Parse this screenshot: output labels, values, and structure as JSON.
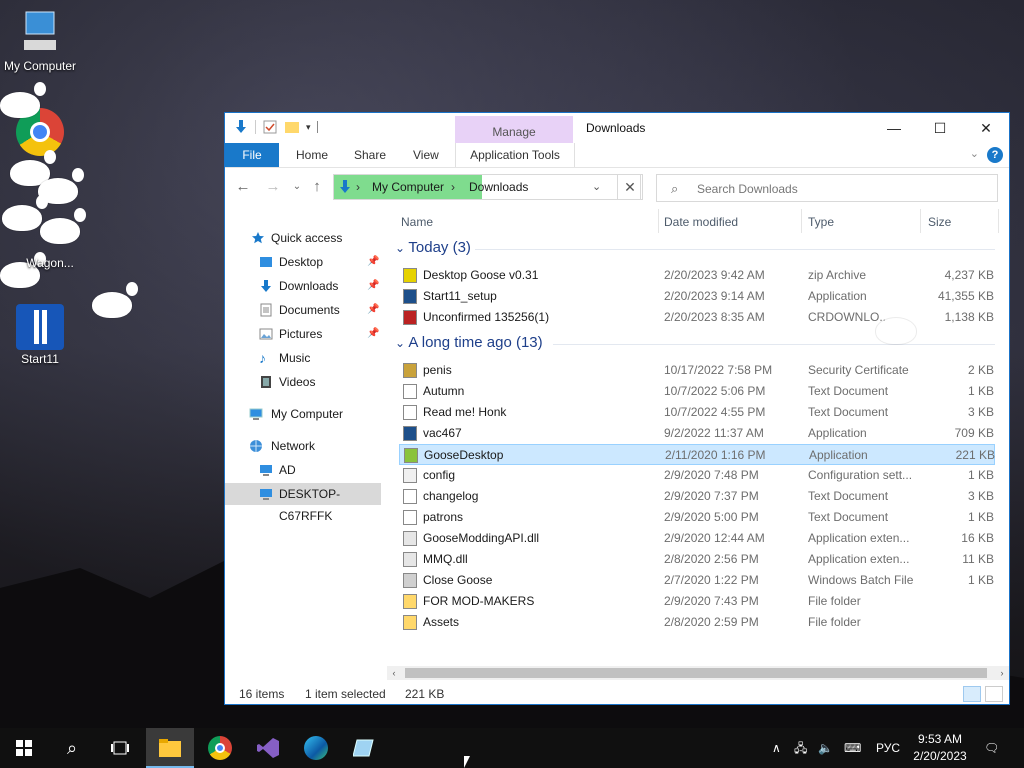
{
  "desktop": {
    "icons": [
      {
        "label": "My Computer"
      },
      {
        "label": "Wagon..."
      },
      {
        "label": "Start11"
      }
    ]
  },
  "window": {
    "title": "Downloads",
    "contextual_tab": "Manage",
    "contextual_group": "Application Tools",
    "ribbon_tabs": [
      "File",
      "Home",
      "Share",
      "View"
    ],
    "controls": {
      "minimize": "—",
      "maximize": "☐",
      "close": "✕"
    }
  },
  "address": {
    "segments": [
      "My Computer",
      "Downloads"
    ],
    "separator": "›"
  },
  "search": {
    "placeholder": "Search Downloads"
  },
  "nav": {
    "quick_access": "Quick access",
    "items": [
      {
        "label": "Desktop",
        "pinned": true
      },
      {
        "label": "Downloads",
        "pinned": true
      },
      {
        "label": "Documents",
        "pinned": true
      },
      {
        "label": "Pictures",
        "pinned": true
      },
      {
        "label": "Music",
        "pinned": false
      },
      {
        "label": "Videos",
        "pinned": false
      }
    ],
    "my_computer": "My Computer",
    "network": "Network",
    "network_items": [
      "AD",
      "DESKTOP-C67RFFK"
    ]
  },
  "columns": {
    "name": "Name",
    "date": "Date modified",
    "type": "Type",
    "size": "Size"
  },
  "groups": [
    {
      "label": "Today (3)",
      "files": [
        {
          "name": "Desktop Goose v0.31",
          "date": "2/20/2023 9:42 AM",
          "type": "zip Archive",
          "size": "4,237 KB",
          "icon": "zip-icon"
        },
        {
          "name": "Start11_setup",
          "date": "2/20/2023 9:14 AM",
          "type": "Application",
          "size": "41,355 KB",
          "icon": "app-icon"
        },
        {
          "name": "Unconfirmed 135256(1)",
          "date": "2/20/2023 8:35 AM",
          "type": "CRDOWNLO...",
          "size": "1,138 KB",
          "icon": "partial-download-icon"
        }
      ]
    },
    {
      "label": "A long time ago (13)",
      "files": [
        {
          "name": "penis",
          "date": "10/17/2022 7:58 PM",
          "type": "Security Certificate",
          "size": "2 KB",
          "icon": "certificate-icon"
        },
        {
          "name": "Autumn",
          "date": "10/7/2022 5:06 PM",
          "type": "Text Document",
          "size": "1 KB",
          "icon": "text-file-icon"
        },
        {
          "name": "Read me! Honk",
          "date": "10/7/2022 4:55 PM",
          "type": "Text Document",
          "size": "3 KB",
          "icon": "text-file-icon"
        },
        {
          "name": "vac467",
          "date": "9/2/2022 11:37 AM",
          "type": "Application",
          "size": "709 KB",
          "icon": "app-icon"
        },
        {
          "name": "GooseDesktop",
          "date": "2/11/2020 1:16 PM",
          "type": "Application",
          "size": "221 KB",
          "icon": "goose-app-icon",
          "selected": true
        },
        {
          "name": "config",
          "date": "2/9/2020 7:48 PM",
          "type": "Configuration sett...",
          "size": "1 KB",
          "icon": "config-file-icon"
        },
        {
          "name": "changelog",
          "date": "2/9/2020 7:37 PM",
          "type": "Text Document",
          "size": "3 KB",
          "icon": "text-file-icon"
        },
        {
          "name": "patrons",
          "date": "2/9/2020 5:00 PM",
          "type": "Text Document",
          "size": "1 KB",
          "icon": "text-file-icon"
        },
        {
          "name": "GooseModdingAPI.dll",
          "date": "2/9/2020 12:44 AM",
          "type": "Application exten...",
          "size": "16 KB",
          "icon": "dll-icon"
        },
        {
          "name": "MMQ.dll",
          "date": "2/8/2020 2:56 PM",
          "type": "Application exten...",
          "size": "11 KB",
          "icon": "dll-icon"
        },
        {
          "name": "Close Goose",
          "date": "2/7/2020 1:22 PM",
          "type": "Windows Batch File",
          "size": "1 KB",
          "icon": "batch-file-icon"
        },
        {
          "name": "FOR MOD-MAKERS",
          "date": "2/9/2020 7:43 PM",
          "type": "File folder",
          "size": "",
          "icon": "folder-icon"
        },
        {
          "name": "Assets",
          "date": "2/8/2020 2:59 PM",
          "type": "File folder",
          "size": "",
          "icon": "folder-icon"
        }
      ]
    }
  ],
  "status": {
    "items": "16 items",
    "selected": "1 item selected",
    "size": "221 KB"
  },
  "taskbar": {
    "language": "РУС",
    "time": "9:53 AM",
    "date": "2/20/2023"
  },
  "colors": {
    "accent": "#1979ca",
    "selection": "#cce8ff",
    "address_highlight": "#69d67a",
    "manage_tab": "#e8d2f7"
  }
}
